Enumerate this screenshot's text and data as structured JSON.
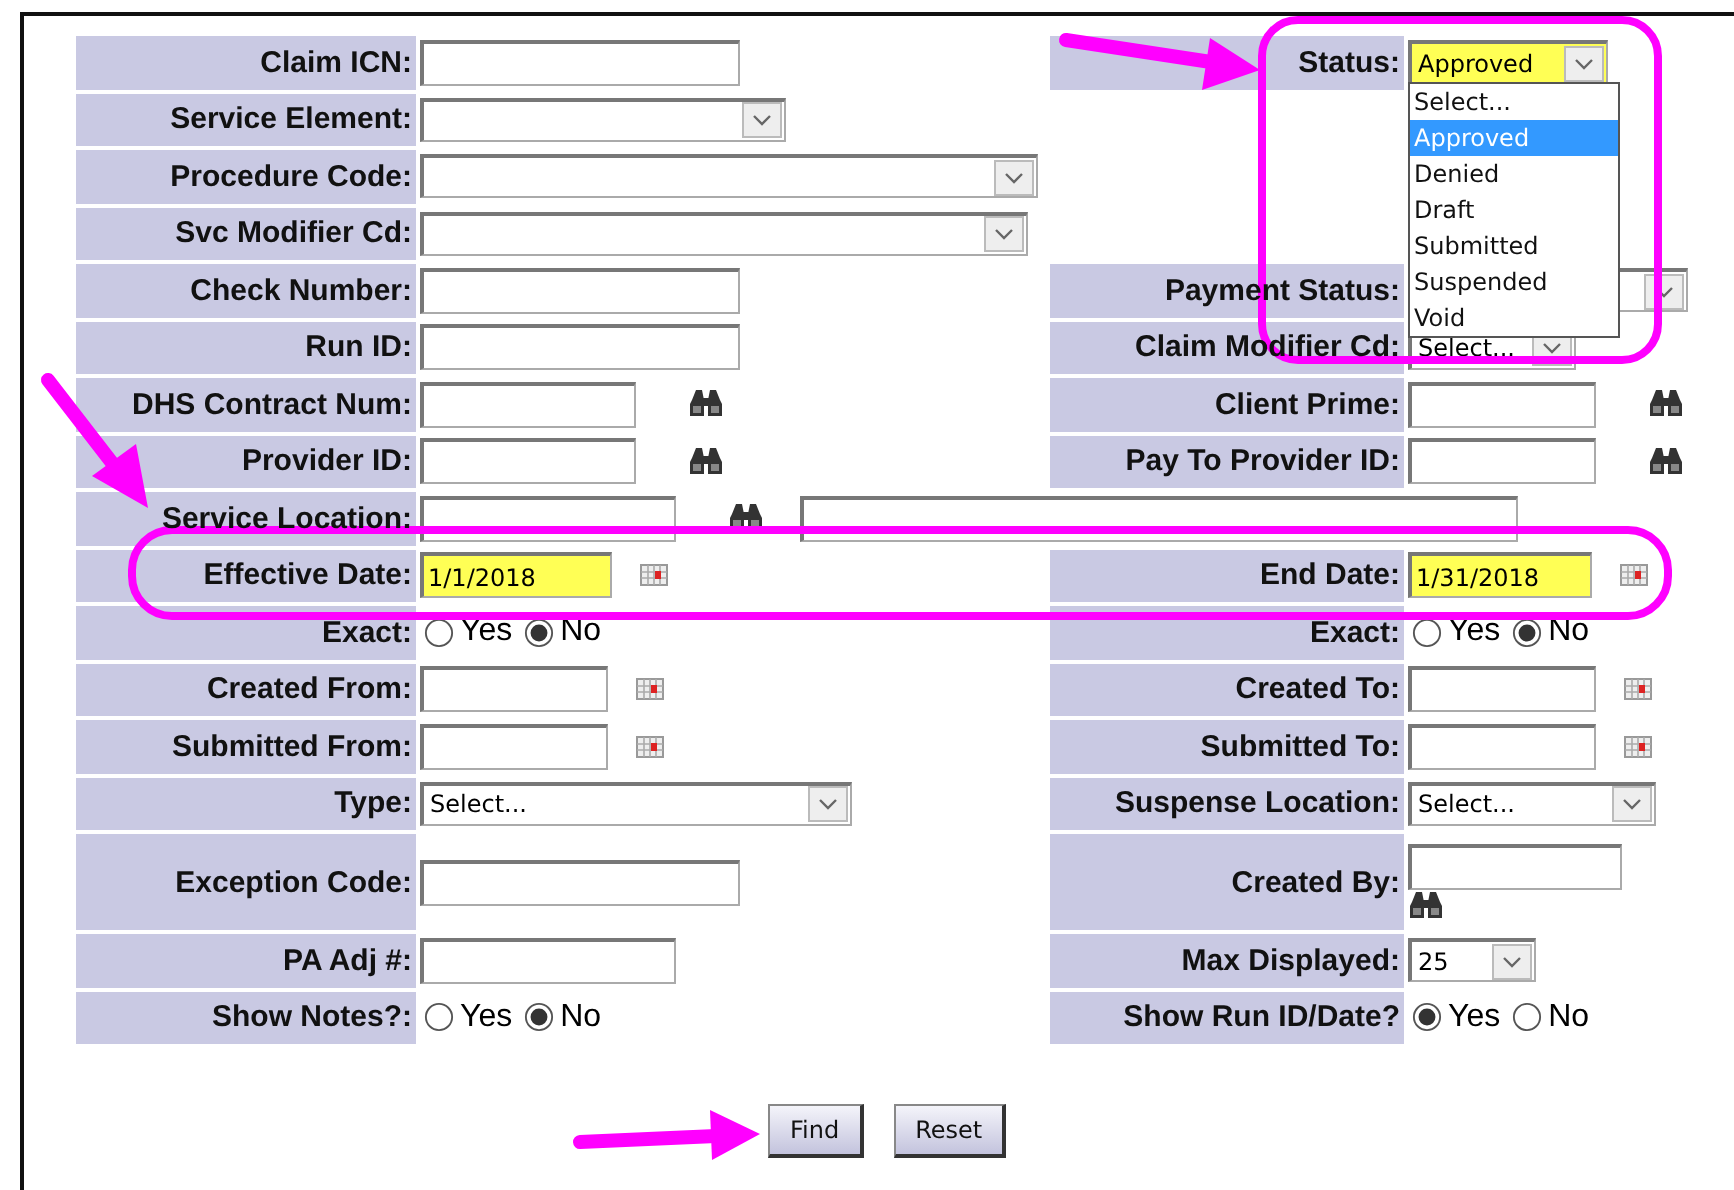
{
  "form": {
    "rows": [
      {
        "left": {
          "label": "Claim ICN:",
          "kind": "text"
        },
        "right": {
          "label": "Status:",
          "kind": "select",
          "value": "Approved",
          "highlighted": true,
          "open": true,
          "options": [
            {
              "label": "Select...",
              "selected": false
            },
            {
              "label": "Approved",
              "selected": true
            },
            {
              "label": "Denied",
              "selected": false
            },
            {
              "label": "Draft",
              "selected": false
            },
            {
              "label": "Submitted",
              "selected": false
            },
            {
              "label": "Suspended",
              "selected": false
            },
            {
              "label": "Void",
              "selected": false
            }
          ]
        }
      },
      {
        "left": {
          "label": "Service Element:",
          "kind": "select"
        }
      },
      {
        "left": {
          "label": "Procedure Code:",
          "kind": "select"
        }
      },
      {
        "left": {
          "label": "Svc Modifier Cd:",
          "kind": "select"
        }
      },
      {
        "left": {
          "label": "Check Number:",
          "kind": "text"
        },
        "right": {
          "label": "Payment Status:",
          "kind": "select"
        }
      },
      {
        "left": {
          "label": "Run ID:",
          "kind": "text"
        },
        "right": {
          "label": "Claim Modifier Cd:",
          "kind": "select",
          "value": "Select..."
        }
      },
      {
        "left": {
          "label": "DHS Contract Num:",
          "kind": "lookup"
        },
        "right": {
          "label": "Client Prime:",
          "kind": "lookup"
        }
      },
      {
        "left": {
          "label": "Provider ID:",
          "kind": "lookup"
        },
        "right": {
          "label": "Pay To Provider ID:",
          "kind": "lookup"
        }
      },
      {
        "left": {
          "label": "Service Location:",
          "kind": "lookup_wide"
        }
      },
      {
        "left": {
          "label": "Effective Date:",
          "kind": "date",
          "value": "1/1/2018",
          "highlighted": true
        },
        "right": {
          "label": "End Date:",
          "kind": "date",
          "value": "1/31/2018",
          "highlighted": true
        }
      },
      {
        "left": {
          "label": "Exact:",
          "kind": "radio",
          "options": [
            {
              "label": "Yes",
              "selected": false
            },
            {
              "label": "No",
              "selected": true
            }
          ]
        },
        "right": {
          "label": "Exact:",
          "kind": "radio",
          "options": [
            {
              "label": "Yes",
              "selected": false
            },
            {
              "label": "No",
              "selected": true
            }
          ]
        }
      },
      {
        "left": {
          "label": "Created From:",
          "kind": "date"
        },
        "right": {
          "label": "Created To:",
          "kind": "date"
        }
      },
      {
        "left": {
          "label": "Submitted From:",
          "kind": "date"
        },
        "right": {
          "label": "Submitted To:",
          "kind": "date"
        }
      },
      {
        "left": {
          "label": "Type:",
          "kind": "select",
          "value": "Select..."
        },
        "right": {
          "label": "Suspense Location:",
          "kind": "select",
          "value": "Select..."
        }
      },
      {
        "left": {
          "label": "Exception Code:",
          "kind": "text"
        },
        "right": {
          "label": "Created By:",
          "kind": "lookup_below"
        }
      },
      {
        "left": {
          "label": "PA Adj #:",
          "kind": "text"
        },
        "right": {
          "label": "Max Displayed:",
          "kind": "select",
          "value": "25"
        }
      },
      {
        "left": {
          "label": "Show Notes?:",
          "kind": "radio",
          "options": [
            {
              "label": "Yes",
              "selected": false
            },
            {
              "label": "No",
              "selected": true
            }
          ]
        },
        "right": {
          "label": "Show Run ID/Date?",
          "kind": "radio",
          "options": [
            {
              "label": "Yes",
              "selected": true
            },
            {
              "label": "No",
              "selected": false
            }
          ]
        }
      }
    ]
  },
  "buttons": [
    {
      "label": "Find"
    },
    {
      "label": "Reset"
    }
  ]
}
